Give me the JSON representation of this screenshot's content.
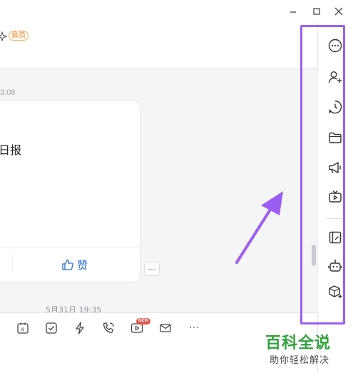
{
  "header": {
    "member_badge": "会员"
  },
  "chat": {
    "time_top": "3:08",
    "card": {
      "title": "日报",
      "like_label": "赞"
    },
    "more_label": "···",
    "time_bottom": "5月31日 19:35"
  },
  "toolbar": {
    "new_badge": "NEW",
    "more_label": "···"
  },
  "window_controls": [
    "minimize",
    "maximize",
    "close"
  ],
  "sidebar": {
    "icons": [
      "more-circle-icon",
      "add-member-icon",
      "history-icon",
      "folder-icon",
      "announcement-icon",
      "live-tv-icon",
      "note-icon",
      "robot-icon",
      "app-box-icon"
    ]
  },
  "annotation": {
    "highlight_color": "#9c5ef2",
    "arrow_color": "#9c5ef2"
  },
  "watermark": {
    "main": "百科全说",
    "sub": "助你轻松解决"
  }
}
